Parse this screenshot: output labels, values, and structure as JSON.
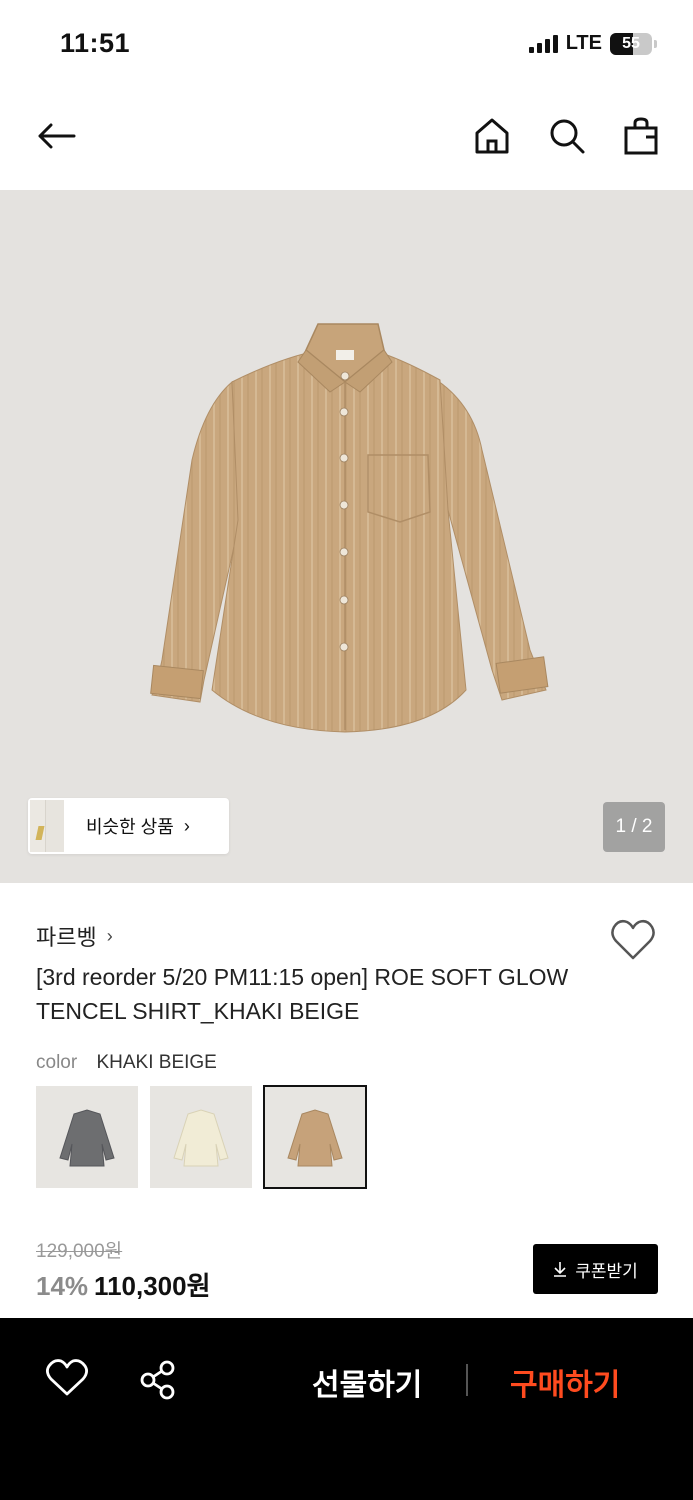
{
  "status_bar": {
    "time": "11:51",
    "network": "LTE",
    "battery": "55",
    "battery_level": 0.55
  },
  "nav": {
    "back_icon": "arrow-left-icon",
    "home_icon": "home-icon",
    "search_icon": "search-icon",
    "bag_icon": "shopping-bag-icon"
  },
  "hero": {
    "similar_label": "비슷한 상품",
    "similar_chevron": "›",
    "page_counter": "1 / 2",
    "background": "#e4e2df"
  },
  "product": {
    "brand": "파르벵",
    "brand_chevron": "›",
    "title": "[3rd reorder 5/20 PM11:15 open] ROE SOFT GLOW TENCEL SHIRT_KHAKI BEIGE",
    "color_label": "color",
    "color_value": "KHAKI BEIGE",
    "swatches": [
      {
        "name": "charcoal",
        "color": "#6d6e70",
        "selected": false
      },
      {
        "name": "cream",
        "color": "#f1ecd6",
        "selected": false
      },
      {
        "name": "khaki-beige",
        "color": "#c6a27a",
        "selected": true
      }
    ],
    "original_price": "129,000원",
    "discount": "14%",
    "sale_price": "110,300원",
    "coupon_label": "쿠폰받기",
    "coupon_icon": "download-icon"
  },
  "bottom_bar": {
    "like_icon": "heart-icon",
    "share_icon": "share-icon",
    "gift_label": "선물하기",
    "buy_label": "구매하기",
    "buy_color": "#ff4b1f"
  }
}
